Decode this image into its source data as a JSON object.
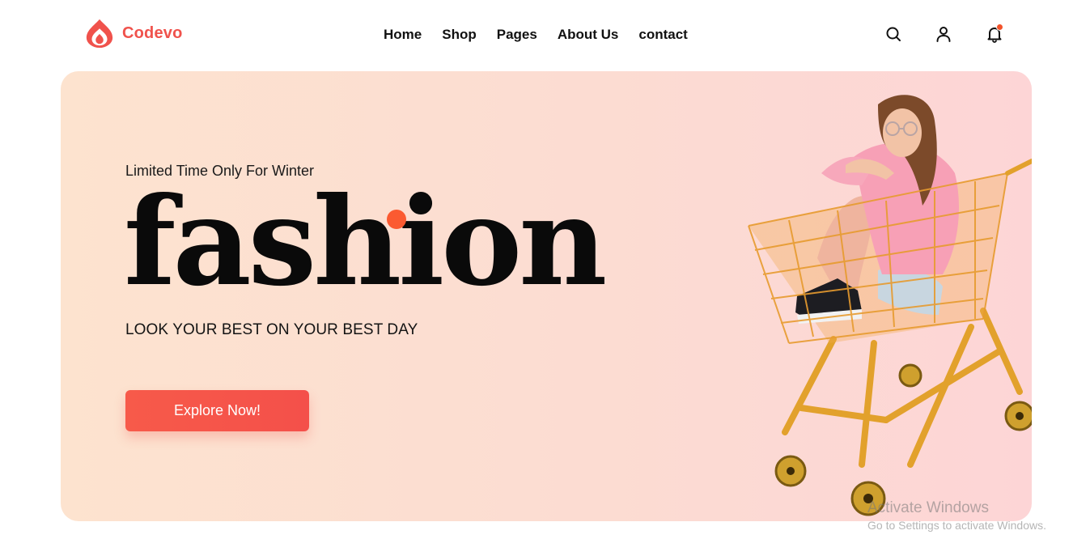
{
  "brand": {
    "name": "Codevo",
    "accent_color": "#f0524c",
    "icon": "flame-drop-logo-icon"
  },
  "nav": {
    "items": [
      {
        "label": "Home"
      },
      {
        "label": "Shop"
      },
      {
        "label": "Pages"
      },
      {
        "label": "About Us"
      },
      {
        "label": "contact"
      }
    ]
  },
  "header_actions": {
    "search_icon": "search-icon",
    "account_icon": "user-icon",
    "notification_icon": "bell-icon",
    "notification_dot_color": "#f3522a"
  },
  "hero": {
    "tagline": "Limited Time Only For Winter",
    "headline": "fashion",
    "subheadline": "LOOK YOUR BEST ON YOUR BEST DAY",
    "cta_label": "Explore Now!",
    "cta_color": "#f4504a",
    "background_colors": [
      "#fde3cf",
      "#fdd5d6"
    ],
    "image": "woman-in-shopping-cart-photo"
  },
  "os_watermark": {
    "title": "Activate Windows",
    "subtitle": "Go to Settings to activate Windows."
  }
}
